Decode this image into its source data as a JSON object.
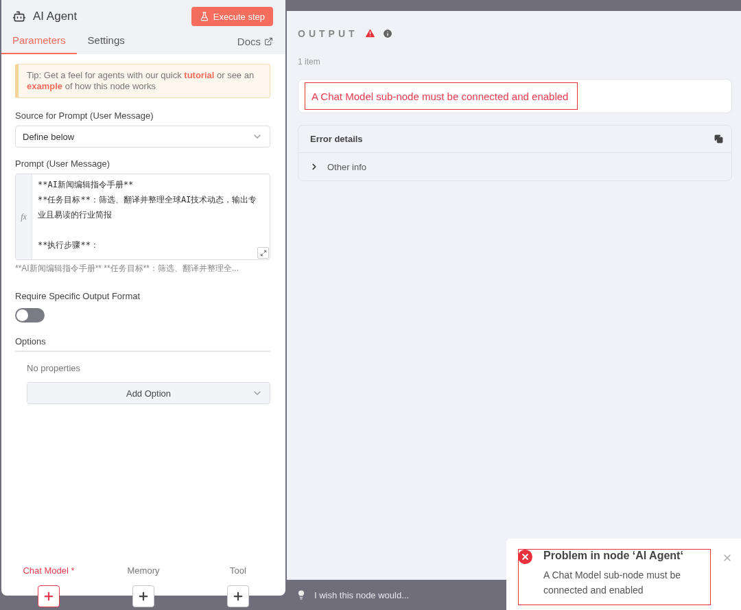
{
  "node": {
    "title": "AI Agent",
    "execute_button": "Execute step"
  },
  "tabs": [
    {
      "label": "Parameters",
      "selected": true
    },
    {
      "label": "Settings",
      "selected": false
    }
  ],
  "docs_link": "Docs",
  "tip": {
    "before": "Tip: Get a feel for agents with our quick ",
    "link_1": "tutorial",
    "middle": " or see an ",
    "link_2": "example",
    "after": " of how this node works"
  },
  "source_field": {
    "label": "Source for Prompt (User Message)",
    "value": "Define below"
  },
  "prompt_field": {
    "label": "Prompt (User Message)",
    "expression_mark": "fx",
    "paragraphs": [
      [
        "**AI新闻编辑指令手册**",
        "**任务目标**：筛选、翻译并整理全球AI技术动态，输出专业且易读的行业简报"
      ],
      [
        "**执行步骤**："
      ]
    ],
    "preview": "**AI新闻编辑指令手册**  **任务目标**：筛选、翻译并整理全..."
  },
  "output_format": {
    "label": "Require Specific Output Format",
    "on": false
  },
  "options": {
    "title": "Options",
    "empty_text": "No properties",
    "add_button": "Add Option"
  },
  "sub_nodes": [
    {
      "label": "Chat Model *",
      "required": true
    },
    {
      "label": "Memory",
      "required": false
    },
    {
      "label": "Tool",
      "required": false
    }
  ],
  "output": {
    "title": "OUTPUT",
    "count": "1 item",
    "error_message": "A Chat Model sub-node must be connected and enabled",
    "error_highlighted": true,
    "details_title": "Error details",
    "details_row": "Other info",
    "expanded": false
  },
  "feedback": {
    "placeholder": "I wish this node would..."
  },
  "toast": {
    "title": "Problem in node ‘AI Agent‘",
    "message": "A Chat Model sub-node must be connected and enabled",
    "highlighted": true
  }
}
